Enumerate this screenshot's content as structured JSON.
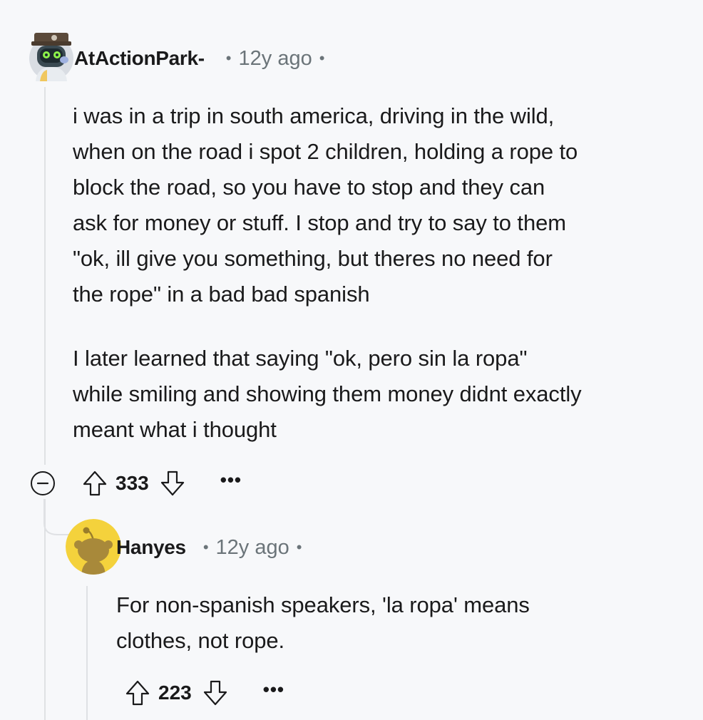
{
  "comment": {
    "username": "AtActionPark-",
    "time": "12y ago",
    "paragraph1": "i was in a trip in south america, driving in the wild,\nwhen on the road i spot 2 children, holding a rope to\nblock the road, so you have to stop and they can\nask for money or stuff. I stop and try to say to them\n\"ok, ill give you something, but theres no need for\nthe rope\" in a bad bad spanish",
    "paragraph2": "I later learned that saying \"ok, pero sin la ropa\"\nwhile smiling and showing them money didnt exactly\nmeant what i thought",
    "score": "333",
    "more": "•••"
  },
  "reply": {
    "username": "Hanyes",
    "time": "12y ago",
    "body": "For non-spanish speakers, 'la ropa' means\nclothes, not rope.",
    "score": "223",
    "more": "•••"
  },
  "colors": {
    "background": "#f7f8fa",
    "text": "#1a1a1b",
    "meta": "#6b7479",
    "thread": "#dfe1e4",
    "snoo_yellow": "#f4d23c"
  },
  "icons": {
    "separator": "•",
    "upvote": "upvote-arrow-icon",
    "downvote": "downvote-arrow-icon",
    "collapse": "collapse-minus-icon"
  }
}
